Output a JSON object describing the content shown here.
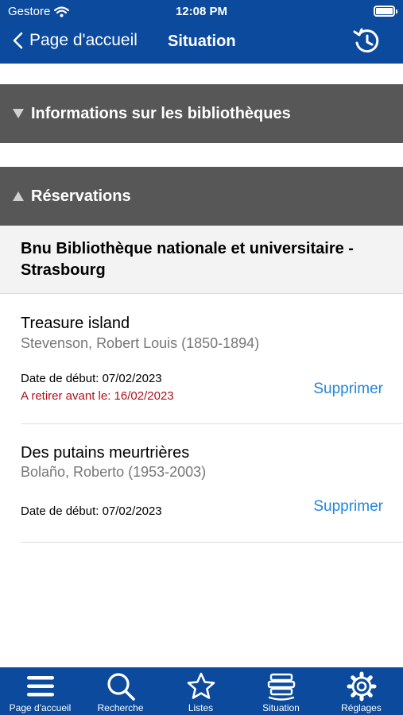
{
  "status_bar": {
    "carrier": "Gestore",
    "time": "12:08 PM",
    "wifi_icon": "wifi-icon",
    "battery_icon": "battery-icon"
  },
  "nav": {
    "back_label": "Page d'accueil",
    "title": "Situation",
    "history_icon": "history-icon"
  },
  "sections": {
    "info": {
      "label": "Informations sur les bibliothèques",
      "expanded": false
    },
    "reservations": {
      "label": "Réservations",
      "expanded": true
    }
  },
  "library": {
    "name": "Bnu Bibliothèque nationale et universitaire - Strasbourg"
  },
  "reservations": [
    {
      "title": "Treasure island",
      "author": "Stevenson, Robert Louis (1850-1894)",
      "start_date": "Date de début: 07/02/2023",
      "pickup_deadline": "A retirer avant le: 16/02/2023",
      "delete_label": "Supprimer"
    },
    {
      "title": "Des putains meurtrières",
      "author": "Bolaño, Roberto (1953-2003)",
      "start_date": "Date de début: 07/02/2023",
      "delete_label": "Supprimer"
    }
  ],
  "tabbar": [
    {
      "label": "Page d'accueil",
      "icon": "menu-icon"
    },
    {
      "label": "Recherche",
      "icon": "search-icon"
    },
    {
      "label": "Listes",
      "icon": "star-icon"
    },
    {
      "label": "Situation",
      "icon": "books-icon"
    },
    {
      "label": "Réglages",
      "icon": "gear-icon"
    }
  ],
  "colors": {
    "header": "#0b4a9c",
    "section_bar": "#575757",
    "link": "#1f86e0",
    "warning": "#b00e1b"
  }
}
